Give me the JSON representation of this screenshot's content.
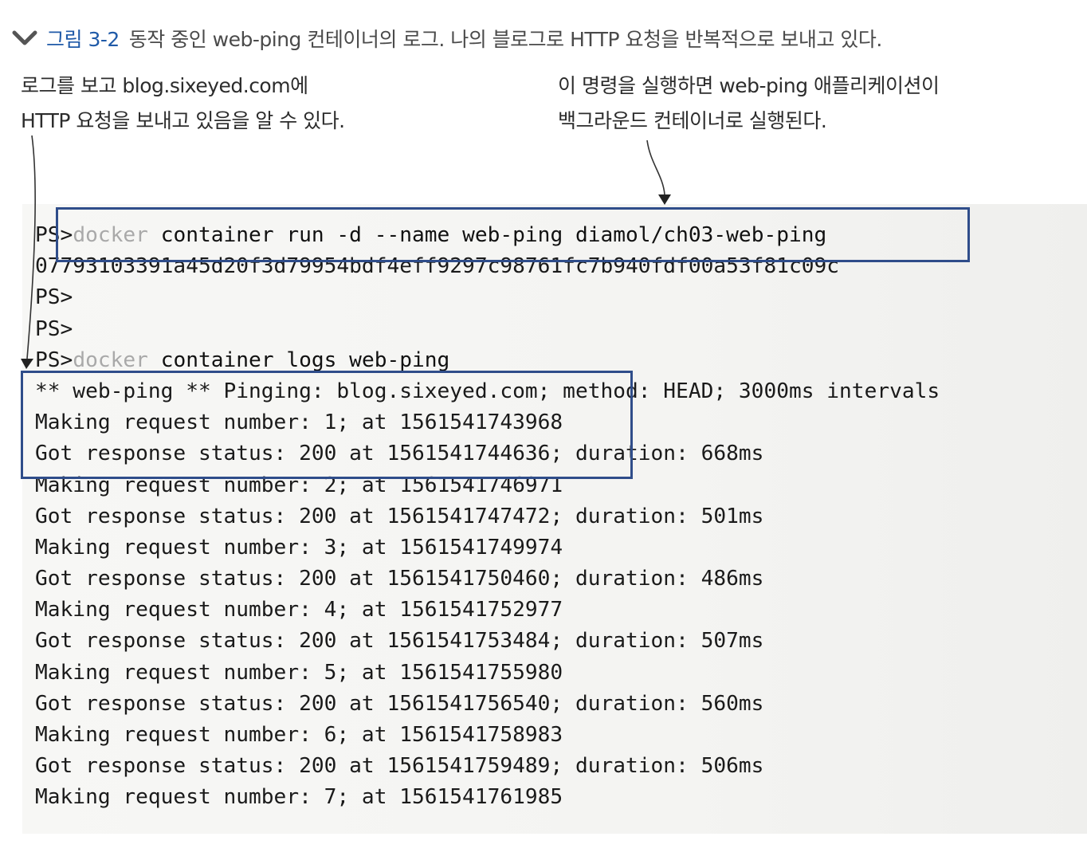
{
  "caption": {
    "chevron_icon": "chevron-down-icon",
    "figure_number": "그림 3-2",
    "text": "동작 중인 web-ping 컨테이너의 로그. 나의 블로그로 HTTP 요청을 반복적으로 보내고 있다."
  },
  "annotations": {
    "left": [
      "로그를 보고 blog.sixeyed.com에",
      "HTTP 요청을 보내고 있음을 알 수 있다."
    ],
    "right": [
      "이 명령을 실행하면 web-ping 애플리케이션이",
      "백그라운드 컨테이너로 실행된다."
    ]
  },
  "terminal": {
    "prompt": "PS>",
    "lines": [
      {
        "prompt": "PS>",
        "docker": "docker",
        "rest": " container run -d --name web-ping diamol/ch03-web-ping"
      },
      {
        "text": "07793103391a45d20f3d79954bdf4eff9297c98761fc7b940fdf00a53f81c09c"
      },
      {
        "prompt": "PS>"
      },
      {
        "prompt": "PS>"
      },
      {
        "prompt": "PS>",
        "docker": "docker",
        "rest": " container logs web-ping"
      },
      {
        "text": "** web-ping ** Pinging: blog.sixeyed.com; method: HEAD; 3000ms intervals"
      },
      {
        "text": "Making request number: 1; at 1561541743968"
      },
      {
        "text": "Got response status: 200 at 1561541744636; duration: 668ms"
      },
      {
        "text": "Making request number: 2; at 1561541746971"
      },
      {
        "text": "Got response status: 200 at 1561541747472; duration: 501ms"
      },
      {
        "text": "Making request number: 3; at 1561541749974"
      },
      {
        "text": "Got response status: 200 at 1561541750460; duration: 486ms"
      },
      {
        "text": "Making request number: 4; at 1561541752977"
      },
      {
        "text": "Got response status: 200 at 1561541753484; duration: 507ms"
      },
      {
        "text": "Making request number: 5; at 1561541755980"
      },
      {
        "text": "Got response status: 200 at 1561541756540; duration: 560ms"
      },
      {
        "text": "Making request number: 6; at 1561541758983"
      },
      {
        "text": "Got response status: 200 at 1561541759489; duration: 506ms"
      },
      {
        "text": "Making request number: 7; at 1561541761985"
      }
    ]
  },
  "colors": {
    "highlight_box": "#2f4d8a",
    "figure_number": "#1f5aa8",
    "docker_keyword": "#a9a9a9"
  }
}
